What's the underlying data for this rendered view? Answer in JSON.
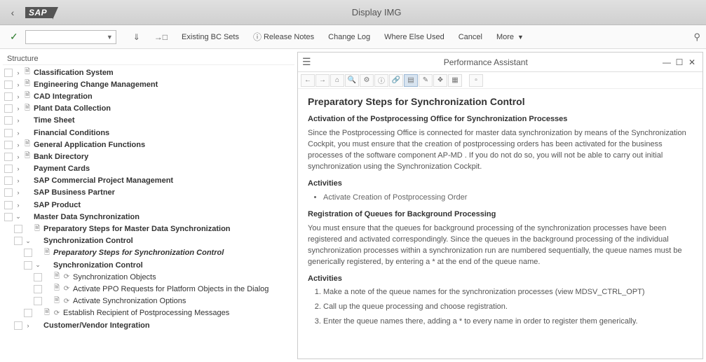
{
  "header": {
    "title": "Display IMG",
    "logo_text": "SAP"
  },
  "toolbar": {
    "existing_bc": "Existing BC Sets",
    "release_notes": "Release Notes",
    "change_log": "Change Log",
    "where_else": "Where Else Used",
    "cancel": "Cancel",
    "more": "More"
  },
  "tree": {
    "header": "Structure",
    "items": [
      {
        "level": 1,
        "exp": ">",
        "ico": "doc",
        "label": "Classification System",
        "bold": true
      },
      {
        "level": 1,
        "exp": ">",
        "ico": "doc",
        "label": "Engineering Change Management",
        "bold": true
      },
      {
        "level": 1,
        "exp": ">",
        "ico": "doc",
        "label": "CAD Integration",
        "bold": true
      },
      {
        "level": 1,
        "exp": ">",
        "ico": "doc",
        "label": "Plant Data Collection",
        "bold": true
      },
      {
        "level": 1,
        "exp": ">",
        "ico": "",
        "label": "Time Sheet",
        "bold": true
      },
      {
        "level": 1,
        "exp": ">",
        "ico": "",
        "label": "Financial Conditions",
        "bold": true
      },
      {
        "level": 1,
        "exp": ">",
        "ico": "doc",
        "label": "General Application Functions",
        "bold": true
      },
      {
        "level": 1,
        "exp": ">",
        "ico": "doc",
        "label": "Bank Directory",
        "bold": true
      },
      {
        "level": 1,
        "exp": ">",
        "ico": "",
        "label": "Payment Cards",
        "bold": true
      },
      {
        "level": 1,
        "exp": ">",
        "ico": "",
        "label": "SAP Commercial Project Management",
        "bold": true
      },
      {
        "level": 1,
        "exp": ">",
        "ico": "",
        "label": "SAP Business Partner",
        "bold": true
      },
      {
        "level": 1,
        "exp": ">",
        "ico": "",
        "label": "SAP Product",
        "bold": true
      },
      {
        "level": 1,
        "exp": "v",
        "ico": "",
        "label": "Master Data Synchronization",
        "bold": true
      },
      {
        "level": 2,
        "exp": "",
        "ico": "doc",
        "label": "Preparatory Steps for Master Data Synchronization",
        "bold": true
      },
      {
        "level": 2,
        "exp": "v",
        "ico": "",
        "label": "Synchronization Control",
        "bold": true
      },
      {
        "level": 3,
        "exp": "",
        "ico": "doc",
        "label": "Preparatory Steps for Synchronization Control",
        "bold": true,
        "italic": true
      },
      {
        "level": 3,
        "exp": "v",
        "ico": "",
        "label": "Synchronization Control",
        "bold": true
      },
      {
        "level": 4,
        "exp": "",
        "ico": "doc",
        "act": "clock",
        "label": "Synchronization Objects"
      },
      {
        "level": 4,
        "exp": "",
        "ico": "doc",
        "act": "clock",
        "label": "Activate PPO Requests for Platform Objects in the Dialog"
      },
      {
        "level": 4,
        "exp": "",
        "ico": "doc",
        "act": "clock",
        "label": "Activate Synchronization Options"
      },
      {
        "level": 3,
        "exp": "",
        "ico": "doc",
        "act": "clock",
        "label": "Establish Recipient of Postprocessing Messages"
      },
      {
        "level": 2,
        "exp": ">",
        "ico": "",
        "label": "Customer/Vendor Integration",
        "bold": true
      }
    ]
  },
  "assistant": {
    "title": "Performance Assistant",
    "doc_title": "Preparatory Steps for Synchronization Control",
    "sec1_title": "Activation of the Postprocessing Office for Synchronization Processes",
    "sec1_para": "Since the Postprocessing Office is connected for master data synchronization by means of the Synchronization Cockpit, you must ensure that the creation of postprocessing orders has been activated for the business processes of the software component AP-MD . If you do not do so, you will not be able to carry out initial synchronization using the Synchronization Cockpit.",
    "activities_label": "Activities",
    "activity1": "Activate Creation of Postprocessing Order",
    "sec2_title": "Registration of Queues for Background Processing",
    "sec2_para": "You must ensure that the queues for background processing of the synchronization processes have been registered and activated correspondingly. Since the queues in the background processing of the individual synchronization processes within a synchronization run are numbered sequentially, the queue names must be generically registered, by entering a * at the end of the queue name.",
    "ol1": "Make a note of the queue names for the synchronization processes (view  MDSV_CTRL_OPT)",
    "ol2": "Call up the queue processing and choose registration.",
    "ol3": "Enter the queue names there, adding a * to every name in order to register them generically."
  }
}
